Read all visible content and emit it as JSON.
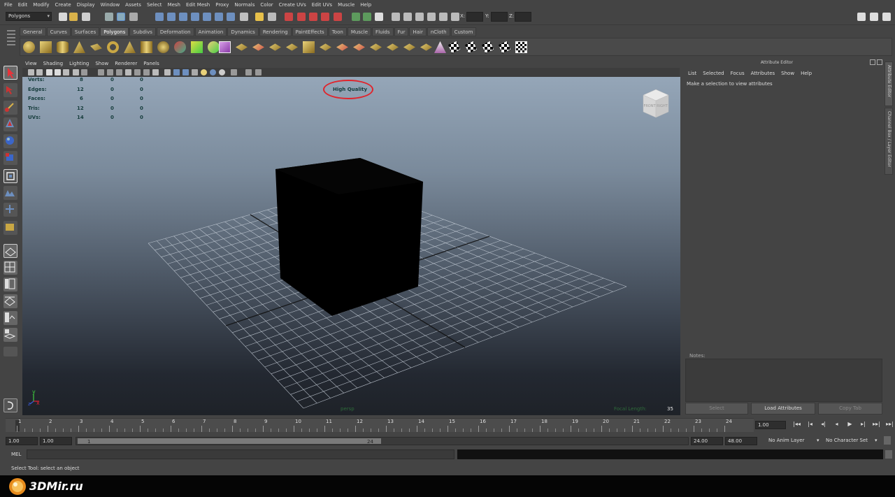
{
  "menu": [
    "File",
    "Edit",
    "Modify",
    "Create",
    "Display",
    "Window",
    "Assets",
    "Select",
    "Mesh",
    "Edit Mesh",
    "Proxy",
    "Normals",
    "Color",
    "Create UVs",
    "Edit UVs",
    "Muscle",
    "Help"
  ],
  "status_line": {
    "mode": "Polygons",
    "x_label": "X:",
    "y_label": "Y:",
    "z_label": "Z:"
  },
  "shelf_tabs": [
    "General",
    "Curves",
    "Surfaces",
    "Polygons",
    "Subdivs",
    "Deformation",
    "Animation",
    "Dynamics",
    "Rendering",
    "PaintEffects",
    "Toon",
    "Muscle",
    "Fluids",
    "Fur",
    "Hair",
    "nCloth",
    "Custom"
  ],
  "shelf_active": "Polygons",
  "panel_menu": [
    "View",
    "Shading",
    "Lighting",
    "Show",
    "Renderer",
    "Panels"
  ],
  "hud": {
    "rows": [
      {
        "label": "Verts:",
        "v1": "8",
        "v2": "0",
        "v3": "0"
      },
      {
        "label": "Edges:",
        "v1": "12",
        "v2": "0",
        "v3": "0"
      },
      {
        "label": "Faces:",
        "v1": "6",
        "v2": "0",
        "v3": "0"
      },
      {
        "label": "Tris:",
        "v1": "12",
        "v2": "0",
        "v3": "0"
      },
      {
        "label": "UVs:",
        "v1": "14",
        "v2": "0",
        "v3": "0"
      }
    ],
    "renderer_label": "High Quality",
    "camera": "persp",
    "focal_length_label": "Focal Length:",
    "focal_length_value": "35",
    "viewcube_front": "FRONT",
    "viewcube_right": "RIGHT",
    "axis_y": "y",
    "axis_x": "x",
    "axis_z": "z"
  },
  "attribute_editor": {
    "title": "Attribute Editor",
    "menu": [
      "List",
      "Selected",
      "Focus",
      "Attributes",
      "Show",
      "Help"
    ],
    "message": "Make a selection to view attributes",
    "notes_label": "Notes:",
    "buttons": {
      "select": "Select",
      "load": "Load Attributes",
      "copy": "Copy Tab"
    }
  },
  "side_tabs": {
    "attribute_editor": "Attribute Editor",
    "channel_box": "Channel Box / Layer Editor"
  },
  "time_slider": {
    "ticks": [
      "1",
      "2",
      "3",
      "4",
      "5",
      "6",
      "7",
      "8",
      "9",
      "10",
      "11",
      "12",
      "13",
      "14",
      "15",
      "16",
      "17",
      "18",
      "19",
      "20",
      "21",
      "22",
      "23",
      "24"
    ],
    "current_frame": "1.00",
    "playback_icons": [
      "|◂◂",
      "|◂",
      "◂|",
      "◂",
      "▶",
      "▸|",
      "▸▸|",
      "▸▸|"
    ]
  },
  "range_slider": {
    "start_time": "1.00",
    "playback_start": "1.00",
    "range_start_label": "1",
    "range_end_label": "24",
    "playback_end": "24.00",
    "end_time": "48.00",
    "anim_layer": "No Anim Layer",
    "character_set": "No Character Set"
  },
  "command_line": {
    "label": "MEL"
  },
  "help_line": "Select Tool: select an object",
  "watermark": "3DMir.ru",
  "colors": {
    "ui_bg": "#444444",
    "viewport_top": "#95a6b8",
    "viewport_bottom": "#1e2228",
    "hud_text": "#163c3c",
    "annotation_circle": "#e0242c",
    "cube": "#000000"
  }
}
